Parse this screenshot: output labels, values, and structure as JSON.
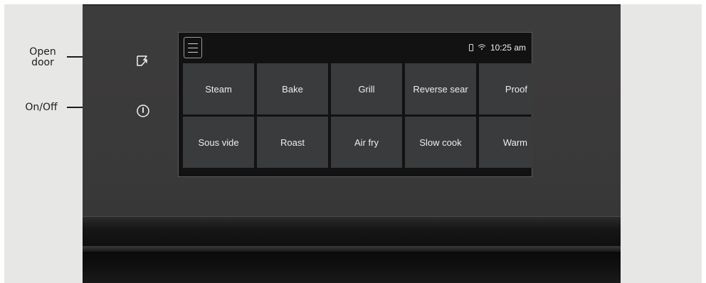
{
  "callouts": {
    "open_door": "Open\ndoor",
    "on_off": "On/Off"
  },
  "panel_icons": {
    "open_door": "door-open-icon",
    "power": "power-icon"
  },
  "screen": {
    "menu_icon": "hamburger-menu-icon",
    "status": {
      "phone_icon": "phone-icon",
      "wifi_icon": "wifi-icon",
      "time": "10:25 am"
    },
    "modes": [
      {
        "label": "Steam"
      },
      {
        "label": "Bake"
      },
      {
        "label": "Grill"
      },
      {
        "label": "Reverse sear"
      },
      {
        "label": "Proof"
      },
      {
        "label": "Sous vide"
      },
      {
        "label": "Roast"
      },
      {
        "label": "Air fry"
      },
      {
        "label": "Slow cook"
      },
      {
        "label": "Warm"
      }
    ]
  },
  "colors": {
    "panel": "#3b3a3a",
    "screen_bg": "#121212",
    "tile": "#393b3c",
    "text": "#eeeeee"
  }
}
